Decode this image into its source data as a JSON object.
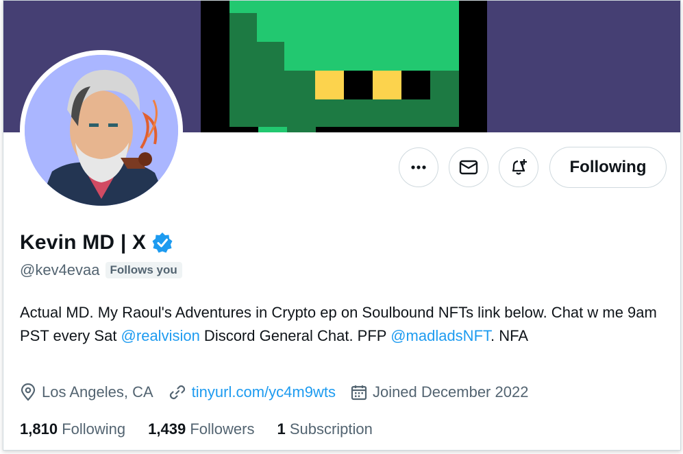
{
  "profile": {
    "display_name": "Kevin MD | X",
    "handle": "@kev4evaa",
    "follows_you": "Follows you",
    "bio": {
      "part1": "Actual MD. My Raoul's Adventures in Crypto ep on Soulbound NFTs link below. Chat w me 9am PST every Sat ",
      "mention1": "@realvision",
      "part2": " Discord General Chat. PFP ",
      "mention2": "@madladsNFT",
      "part3": ". NFA"
    },
    "location": "Los Angeles, CA",
    "website": "tinyurl.com/yc4m9wts",
    "joined": "Joined December 2022"
  },
  "stats": {
    "following_count": "1,810",
    "following_label": "Following",
    "followers_count": "1,439",
    "followers_label": "Followers",
    "subscription_count": "1",
    "subscription_label": "Subscription"
  },
  "actions": {
    "following_button": "Following"
  },
  "icons": {
    "more": "more-icon",
    "message": "envelope-icon",
    "notify": "bell-plus-icon",
    "verified": "verified-badge-icon",
    "location": "location-pin-icon",
    "link": "link-icon",
    "calendar": "calendar-icon"
  },
  "colors": {
    "accent": "#1d9bf0",
    "banner_bg": "#453f73",
    "banner_green": "#22c870",
    "secondary_text": "#536471"
  }
}
